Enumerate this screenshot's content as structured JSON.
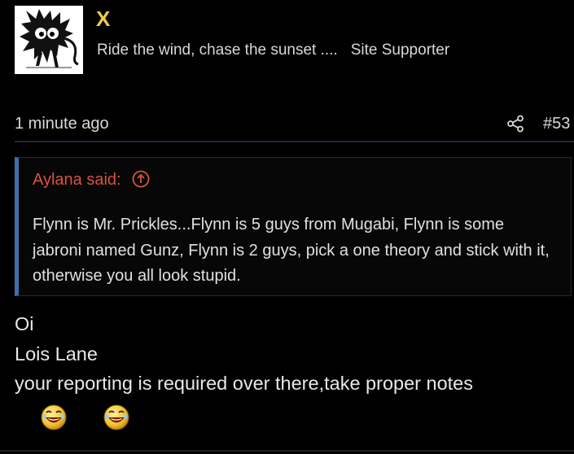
{
  "user": {
    "name": "X",
    "tagline": "Ride the wind, chase the sunset ....",
    "role": "Site Supporter"
  },
  "post": {
    "time": "1 minute ago",
    "number": "#53"
  },
  "quote": {
    "author": "Aylana said:",
    "text": "Flynn is Mr. Prickles...Flynn is 5 guys from Mugabi, Flynn is some jabroni named Gunz, Flynn is 2 guys, pick a one theory and stick with it, otherwise you all look stupid."
  },
  "message": {
    "lines": [
      "Oi",
      "Lois Lane",
      "your reporting is required over there,take proper notes"
    ],
    "smilies": [
      "laughing-emoji",
      "laughing-emoji"
    ]
  },
  "colors": {
    "username": "#f0c94d",
    "quote_author": "#d9533f",
    "quote_border": "#3f6fae",
    "background": "#000000"
  },
  "icons": {
    "share": "share-icon",
    "quote_link": "arrow-up-circle-icon"
  }
}
